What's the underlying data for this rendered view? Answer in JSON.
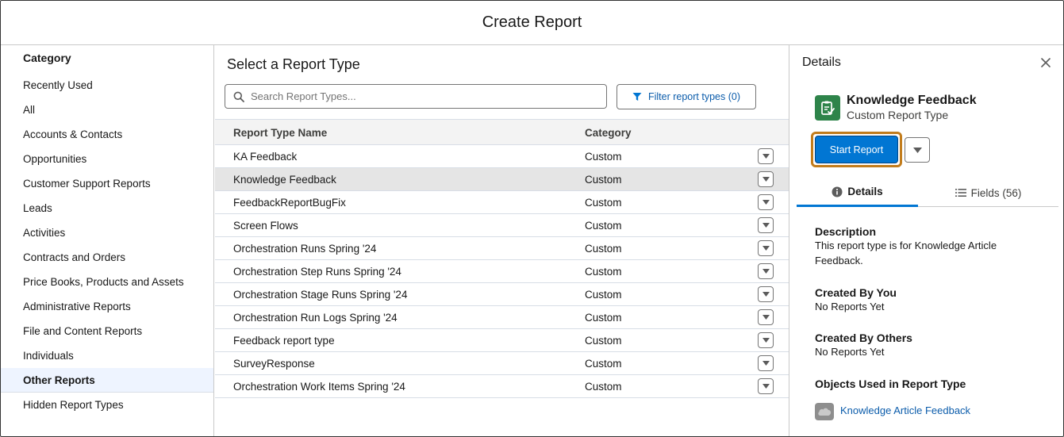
{
  "modal": {
    "title": "Create Report"
  },
  "sidebar": {
    "heading": "Category",
    "items": [
      {
        "label": "Recently Used"
      },
      {
        "label": "All"
      },
      {
        "label": "Accounts & Contacts"
      },
      {
        "label": "Opportunities"
      },
      {
        "label": "Customer Support Reports"
      },
      {
        "label": "Leads"
      },
      {
        "label": "Activities"
      },
      {
        "label": "Contracts and Orders"
      },
      {
        "label": "Price Books, Products and Assets"
      },
      {
        "label": "Administrative Reports"
      },
      {
        "label": "File and Content Reports"
      },
      {
        "label": "Individuals"
      },
      {
        "label": "Other Reports",
        "selected": true
      },
      {
        "label": "Hidden Report Types"
      }
    ]
  },
  "main": {
    "title": "Select a Report Type",
    "search": {
      "placeholder": "Search Report Types...",
      "value": ""
    },
    "filter_label": "Filter report types (0)",
    "columns": {
      "name": "Report Type Name",
      "category": "Category"
    },
    "rows": [
      {
        "name": "KA Feedback",
        "category": "Custom"
      },
      {
        "name": "Knowledge Feedback",
        "category": "Custom",
        "selected": true
      },
      {
        "name": "FeedbackReportBugFix",
        "category": "Custom"
      },
      {
        "name": "Screen Flows",
        "category": "Custom"
      },
      {
        "name": "Orchestration Runs Spring '24",
        "category": "Custom"
      },
      {
        "name": "Orchestration Step Runs Spring '24",
        "category": "Custom"
      },
      {
        "name": "Orchestration Stage Runs Spring '24",
        "category": "Custom"
      },
      {
        "name": "Orchestration Run Logs Spring '24",
        "category": "Custom"
      },
      {
        "name": "Feedback report type",
        "category": "Custom"
      },
      {
        "name": "SurveyResponse",
        "category": "Custom"
      },
      {
        "name": "Orchestration Work Items Spring '24",
        "category": "Custom"
      }
    ]
  },
  "details": {
    "title": "Details",
    "report_type_name": "Knowledge Feedback",
    "report_type_kind": "Custom Report Type",
    "start_label": "Start Report",
    "tabs": {
      "details": "Details",
      "fields": "Fields (56)"
    },
    "description_label": "Description",
    "description": "This report type is for Knowledge Article Feedback.",
    "created_by_you_label": "Created By You",
    "created_by_you": "No Reports Yet",
    "created_by_others_label": "Created By Others",
    "created_by_others": "No Reports Yet",
    "objects_label": "Objects Used in Report Type",
    "object_link": "Knowledge Article Feedback"
  },
  "colors": {
    "brand": "#0176d3",
    "focus": "#c27c1c",
    "report_icon": "#2e844a",
    "link": "#0b5cab"
  },
  "icons": {
    "search": "search-icon",
    "filter": "filter-icon",
    "close": "close-icon",
    "dropdown": "chevron-down-icon",
    "info": "info-icon",
    "list": "list-icon",
    "report_type": "report-type-icon",
    "object": "salesforce-cloud-icon"
  }
}
